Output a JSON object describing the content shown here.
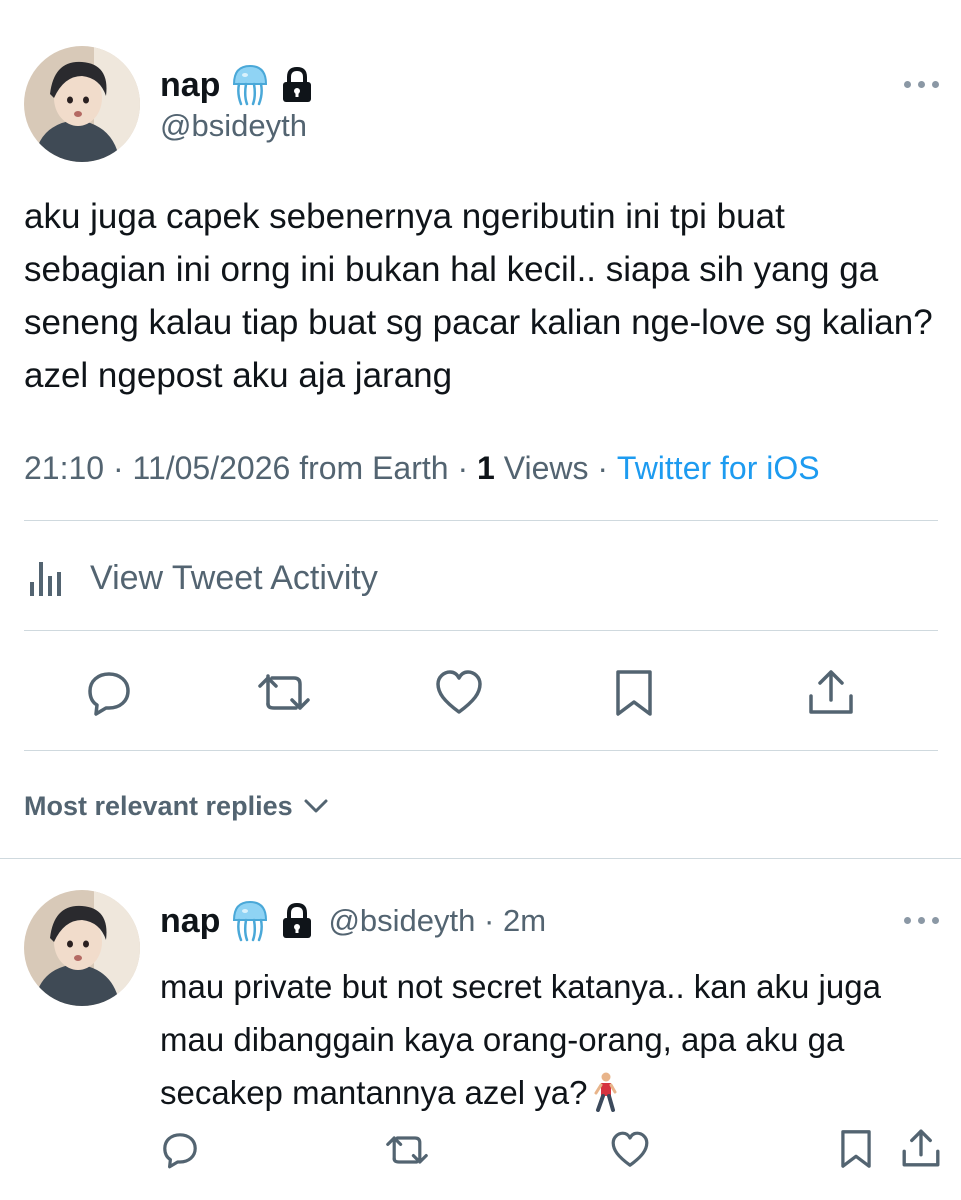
{
  "tweet": {
    "display_name": "nap",
    "handle": "@bsideyth",
    "text": "aku juga capek sebenernya ngeributin ini tpi buat sebagian ini orng ini bukan hal kecil.. siapa sih yang ga seneng kalau tiap buat sg pacar kalian nge-love sg kalian? azel ngepost aku aja jarang",
    "time": "21:10",
    "separator": " · ",
    "date": "11/05/2026",
    "location": " from Earth",
    "views_count": "1",
    "views_label": " Views",
    "source": "Twitter for iOS",
    "icons": {
      "badge": "jellyfish-emoji-icon",
      "locked": "lock-icon",
      "more": "more-icon"
    }
  },
  "activity": {
    "label": "View Tweet Activity",
    "icon": "analytics-icon"
  },
  "actions": [
    "reply-icon",
    "retweet-icon",
    "like-icon",
    "bookmark-icon",
    "share-icon"
  ],
  "replies_sort": {
    "label": "Most relevant replies",
    "icon": "chevron-down-icon"
  },
  "reply": {
    "display_name": "nap",
    "handle": "@bsideyth",
    "separator": " · ",
    "time_ago": "2m",
    "text": "mau private but not secret katanya.. kan aku juga mau dibanggain kaya orang-orang, apa aku ga secakep mantannya azel ya?",
    "emoji": "person-walking-emoji"
  },
  "colors": {
    "text_primary": "#0f1419",
    "text_secondary": "#536471",
    "link": "#1d9bf0",
    "divider": "#cfd9de"
  }
}
